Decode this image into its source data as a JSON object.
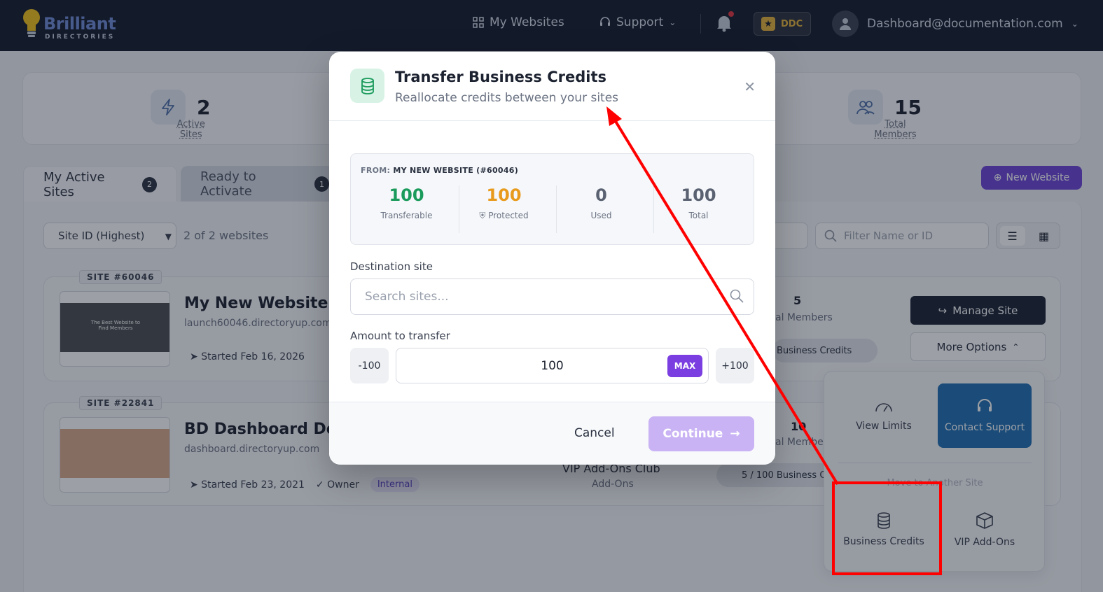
{
  "header": {
    "brand_name": "Brilliant",
    "brand_sub": "DIRECTORIES",
    "nav": {
      "my_websites": "My Websites",
      "support": "Support"
    },
    "ddc_label": "DDC",
    "account_email": "Dashboard@documentation.com"
  },
  "stats": [
    {
      "value": "2",
      "label": "Active Sites",
      "icon": "lightning-icon"
    },
    {
      "value": "15",
      "label": "Total Members",
      "icon": "users-icon"
    }
  ],
  "tabs": {
    "active": {
      "label": "My Active Sites",
      "count": "2"
    },
    "ready": {
      "label": "Ready to Activate",
      "count": "1"
    }
  },
  "new_website_label": "New Website",
  "list": {
    "sort_value": "Site ID (Highest)",
    "count_text": "2 of 2 websites",
    "filter_placeholder": "Filter Name or ID"
  },
  "sites": [
    {
      "tag": "SITE #60046",
      "name": "My New Website",
      "url": "launch60046.directoryup.com",
      "started": "Started Feb 16, 2026",
      "thumb_text_1": "The Best Website to",
      "thumb_text_2": "Find Members",
      "members_value": "5",
      "members_label": "al Members",
      "credits_label": "Business Credits"
    },
    {
      "tag": "SITE #22841",
      "name": "BD Dashboard Docu",
      "url": "dashboard.directoryup.com",
      "started": "Started Feb 23, 2021",
      "owner": "Owner",
      "internal": "Internal",
      "members_value": "10",
      "members_label": "al Membe",
      "vip_title": "VIP Add-Ons Club",
      "vip_sub": "Add-Ons",
      "credits_label": "5 / 100 Business C"
    }
  ],
  "actions": {
    "manage_site": "Manage Site",
    "more_options": "More Options"
  },
  "dropdown": {
    "view_limits": "View Limits",
    "contact_support": "Contact Support",
    "move_site": "Move to Another Site",
    "business_credits": "Business Credits",
    "vip_addons": "VIP Add-Ons"
  },
  "modal": {
    "title": "Transfer Business Credits",
    "subtitle": "Reallocate credits between your sites",
    "from_prefix": "FROM:",
    "from_site": "MY NEW WEBSITE (#60046)",
    "cells": [
      {
        "value": "100",
        "label": "Transferable",
        "color": "#1a9a5b"
      },
      {
        "value": "100",
        "label": "Protected",
        "color": "#e89a1c"
      },
      {
        "value": "0",
        "label": "Used",
        "color": "#5a6272"
      },
      {
        "value": "100",
        "label": "Total",
        "color": "#5a6272"
      }
    ],
    "destination_label": "Destination site",
    "destination_placeholder": "Search sites...",
    "amount_label": "Amount to transfer",
    "minus_label": "-100",
    "amount_value": "100",
    "max_label": "MAX",
    "plus_label": "+100",
    "cancel_label": "Cancel",
    "continue_label": "Continue"
  },
  "colors": {
    "header_bg": "#131a2b",
    "accent_purple": "#6d46d8",
    "annotation_red": "#ff0000"
  }
}
